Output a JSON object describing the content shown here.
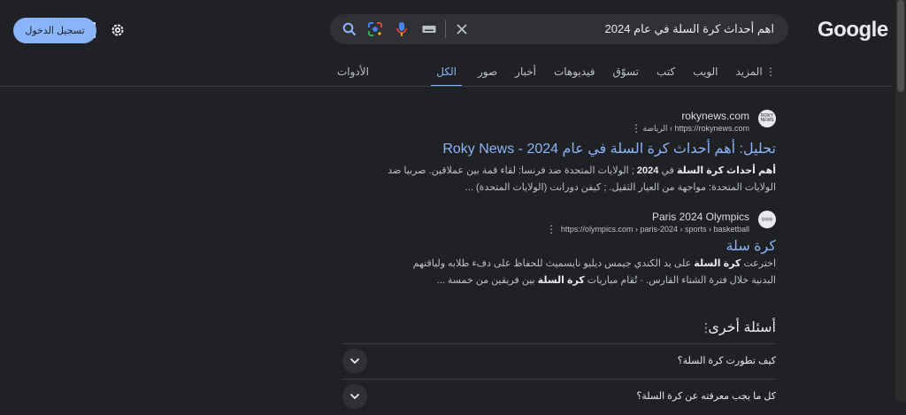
{
  "header": {
    "logo": "Google",
    "query": "اهم أحداث كرة السلة في عام 2024",
    "signin_label": "تسجيل الدخول"
  },
  "tabs": {
    "items": [
      "الكل",
      "صور",
      "أخبار",
      "فيديوهات",
      "تسوّق",
      "كتب",
      "الويب",
      "المزيد"
    ],
    "active": "الكل",
    "tools": "الأدوات"
  },
  "results": [
    {
      "favicon_text": "ROKY NEWS",
      "site_name": "rokynews.com",
      "site_url": "https://rokynews.com › الرياضة",
      "title": "تحليل: أهم أحداث كرة السلة في عام 2024 - Roky News",
      "snippet_bold_1": "أهم أحداث كرة السلة",
      "snippet_mid_1": " في ",
      "snippet_bold_2": "2024",
      "snippet_rest": " ; الولايات المتحدة ضد فرنسا: لقاء قمة بين عملاقين. صربيا ضد الولايات المتحدة: مواجهة من العيار الثقيل. ; كيفن دورانت (الولايات المتحدة) ..."
    },
    {
      "favicon_text": "◎◎◎",
      "site_name": "Paris 2024 Olympics",
      "site_url": "https://olympics.com › paris-2024 › sports › basketball",
      "title": "كرة سلة",
      "snippet_p1": "اخترعت ",
      "snippet_b1": "كرة السلة",
      "snippet_p2": " على يد الكندي جيمس ديليو نايسميث للحفاظ على دفء طلابه ولياقتهم البدنية خلال فترة الشتاء القارس. · تُقام مباريات ",
      "snippet_b2": "كرة السلة",
      "snippet_p3": " بين فريقين من خمسة ..."
    }
  ],
  "paa": {
    "title": "أسئلة أخرى",
    "questions": [
      "كيف تطورت كرة السلة؟",
      "كل ما يجب معرفته عن كرة السلة؟"
    ]
  }
}
